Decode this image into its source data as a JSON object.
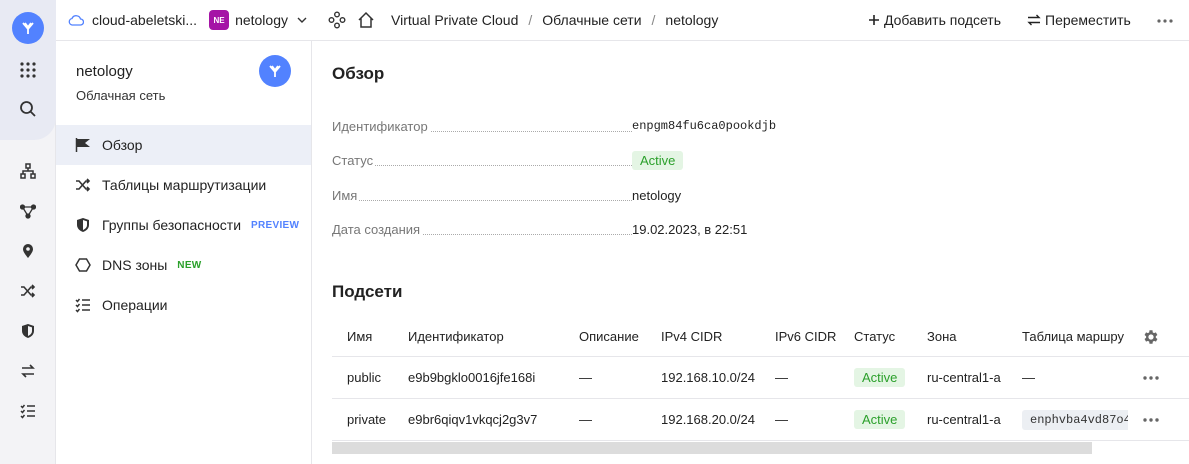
{
  "topbar": {
    "cloud_name": "cloud-abeletski...",
    "folder_badge": "NE",
    "folder_name": "netology",
    "breadcrumbs": [
      "Virtual Private Cloud",
      "Облачные сети",
      "netology"
    ],
    "actions": {
      "add_subnet": "Добавить подсеть",
      "move": "Переместить"
    }
  },
  "panel": {
    "title": "netology",
    "subtitle": "Облачная сеть",
    "nav": [
      {
        "label": "Обзор",
        "icon": "flag-icon",
        "active": true
      },
      {
        "label": "Таблицы маршрутизации",
        "icon": "shuffle-icon"
      },
      {
        "label": "Группы безопасности",
        "icon": "shield-icon",
        "tag": "PREVIEW"
      },
      {
        "label": "DNS зоны",
        "icon": "hexagon-icon",
        "tag": "NEW"
      },
      {
        "label": "Операции",
        "icon": "list-check-icon"
      }
    ]
  },
  "overview": {
    "heading": "Обзор",
    "fields": [
      {
        "key": "Идентификатор",
        "value": "enpgm84fu6ca0pookdjb"
      },
      {
        "key": "Статус",
        "value": "Active"
      },
      {
        "key": "Имя",
        "value": "netology"
      },
      {
        "key": "Дата создания",
        "value": "19.02.2023, в 22:51"
      }
    ]
  },
  "subnets": {
    "heading": "Подсети",
    "columns": [
      "Имя",
      "Идентификатор",
      "Описание",
      "IPv4 CIDR",
      "IPv6 CIDR",
      "Статус",
      "Зона",
      "Таблица маршру"
    ],
    "rows": [
      {
        "name": "public",
        "id": "e9b9bgklo0016jfe168i",
        "description": "—",
        "ipv4": "192.168.10.0/24",
        "ipv6": "—",
        "status": "Active",
        "zone": "ru-central1-a",
        "route_table": "—"
      },
      {
        "name": "private",
        "id": "e9br6qiqv1vkqcj2g3v7",
        "description": "—",
        "ipv4": "192.168.20.0/24",
        "ipv6": "—",
        "status": "Active",
        "zone": "ru-central1-a",
        "route_table": "enphvba4vd87o4"
      }
    ]
  },
  "colors": {
    "accent": "#5282ff",
    "active_bg": "#e4f5e4",
    "active_text": "#2ba02b",
    "folder_badge": "#a514a6"
  }
}
